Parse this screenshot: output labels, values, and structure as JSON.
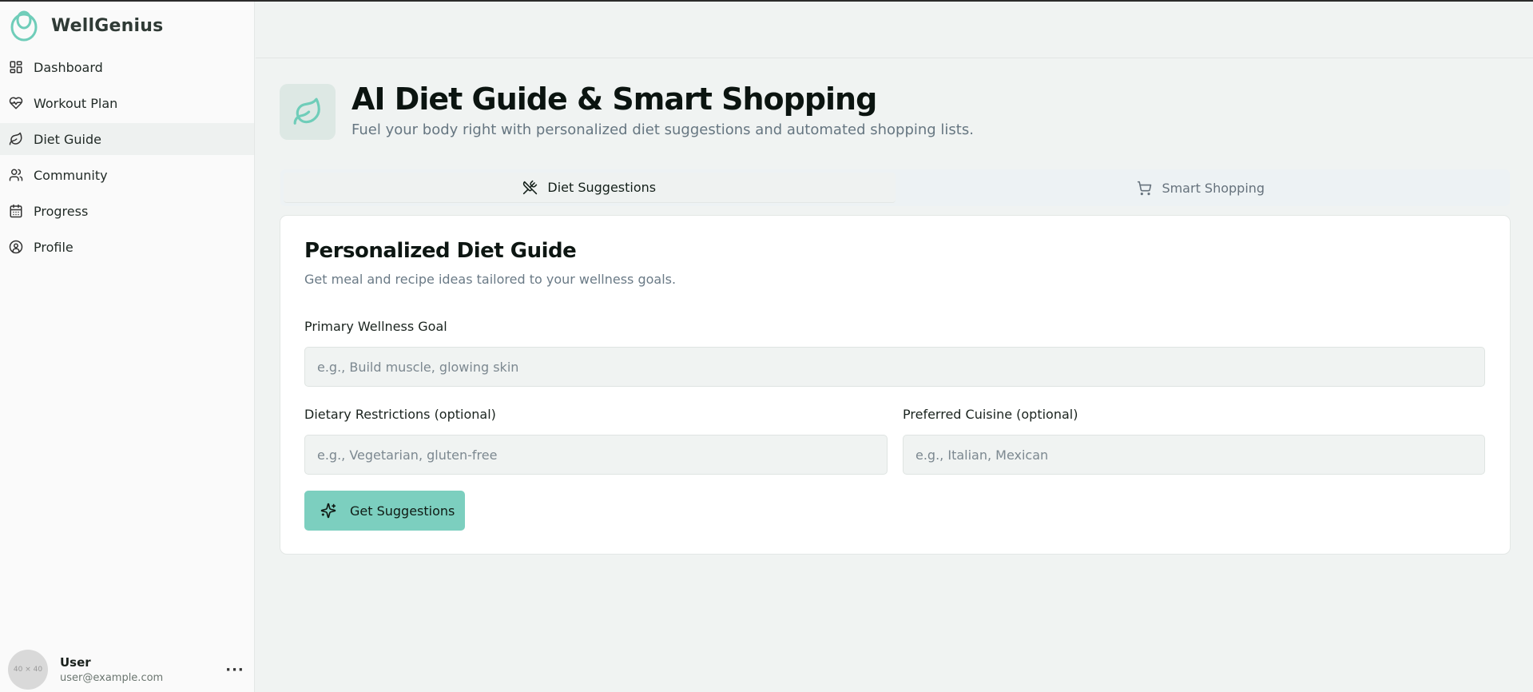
{
  "app": {
    "name": "WellGenius"
  },
  "sidebar": {
    "items": [
      {
        "label": "Dashboard",
        "icon": "dashboard-icon"
      },
      {
        "label": "Workout Plan",
        "icon": "heart-pulse-icon"
      },
      {
        "label": "Diet Guide",
        "icon": "leaf-icon",
        "active": true
      },
      {
        "label": "Community",
        "icon": "users-icon"
      },
      {
        "label": "Progress",
        "icon": "calendar-icon"
      },
      {
        "label": "Profile",
        "icon": "user-circle-icon"
      }
    ],
    "user": {
      "name": "User",
      "email": "user@example.com",
      "avatar_text": "40 × 40",
      "more": "···"
    }
  },
  "header": {
    "title": "AI Diet Guide & Smart Shopping",
    "subtitle": "Fuel your body right with personalized diet suggestions and automated shopping lists."
  },
  "tabs": [
    {
      "label": "Diet Suggestions",
      "icon": "utensils-crossed-icon",
      "active": true
    },
    {
      "label": "Smart Shopping",
      "icon": "shopping-cart-icon",
      "active": false
    }
  ],
  "card": {
    "title": "Personalized Diet Guide",
    "description": "Get meal and recipe ideas tailored to your wellness goals.",
    "fields": {
      "goal": {
        "label": "Primary Wellness Goal",
        "placeholder": "e.g., Build muscle, glowing skin",
        "value": ""
      },
      "restrictions": {
        "label": "Dietary Restrictions (optional)",
        "placeholder": "e.g., Vegetarian, gluten-free",
        "value": ""
      },
      "cuisine": {
        "label": "Preferred Cuisine (optional)",
        "placeholder": "e.g., Italian, Mexican",
        "value": ""
      }
    },
    "button": {
      "label": "Get Suggestions",
      "icon": "sparkles-icon"
    }
  },
  "colors": {
    "accent": "#7ccfbf",
    "logo": "#6fcdb9",
    "background": "#f0f3f2"
  }
}
